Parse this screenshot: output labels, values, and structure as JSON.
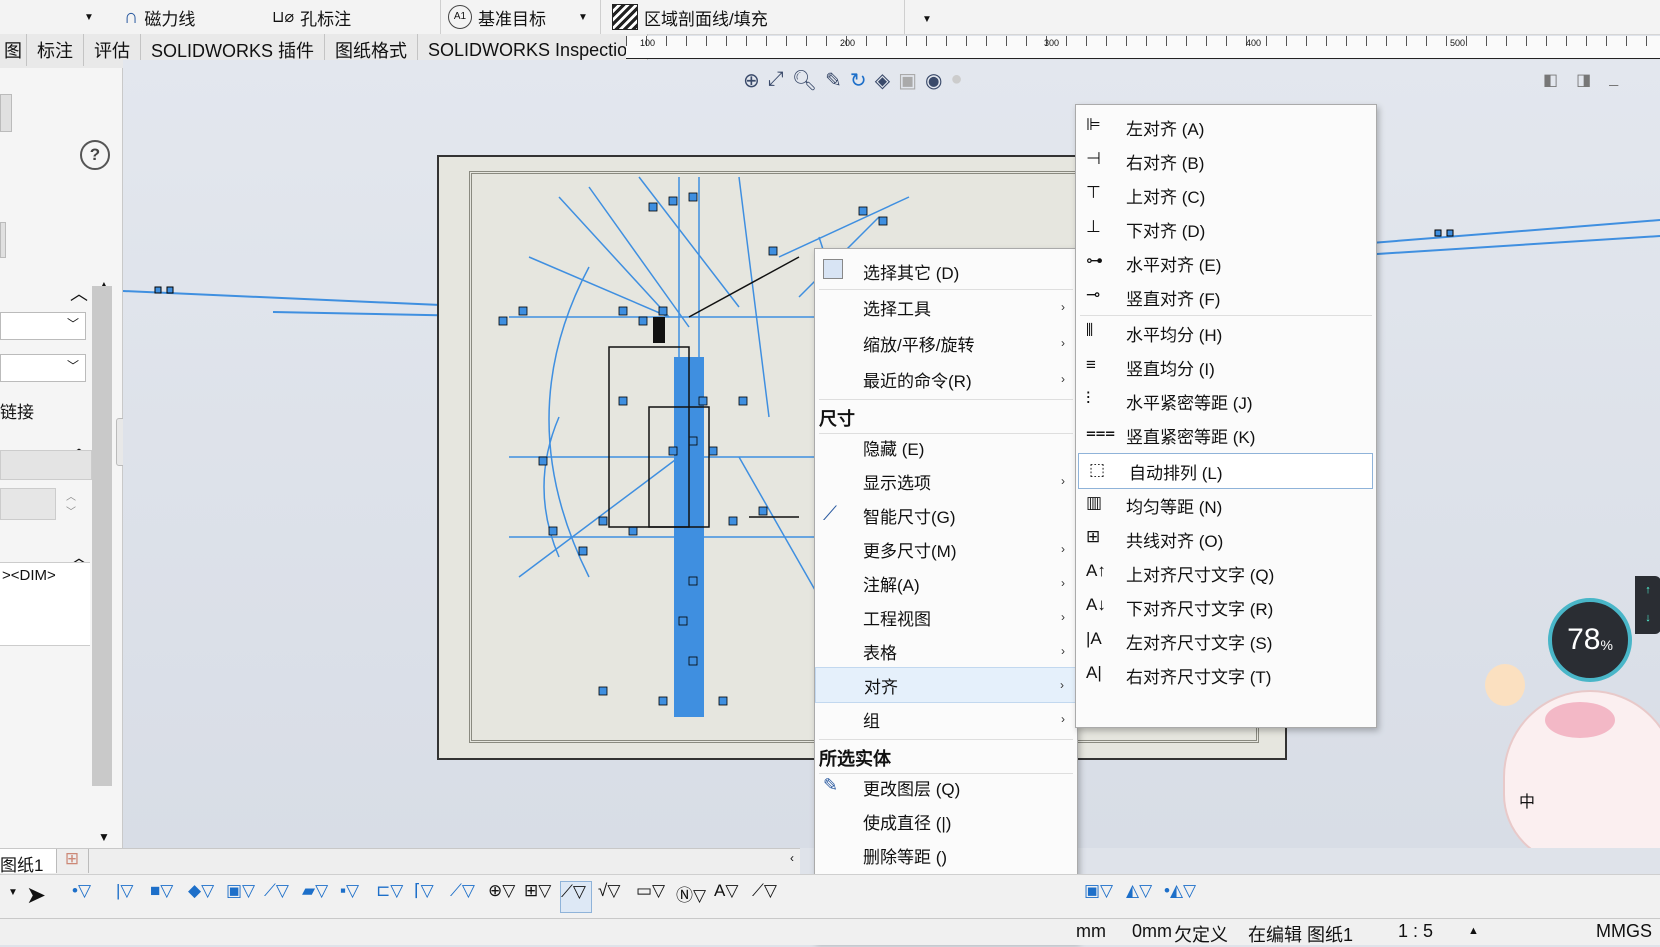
{
  "ribbon": {
    "items": [
      "磁力线",
      "孔标注",
      "基准目标",
      "区域剖面线/填充"
    ]
  },
  "tabs": [
    "图",
    "标注",
    "评估",
    "SOLIDWORKS 插件",
    "图纸格式",
    "SOLIDWORKS Inspection"
  ],
  "ruler_ticks": [
    "100",
    "200",
    "300",
    "400",
    "500"
  ],
  "left_panel": {
    "help_glyph": "?",
    "link_text": "链接",
    "dim_text": "><DIM>"
  },
  "context_menu": {
    "items": [
      {
        "label": "选择其它 (D)",
        "icon": "select-other-icon",
        "submenu": false
      },
      {
        "label": "选择工具",
        "submenu": true
      },
      {
        "label": "缩放/平移/旋转",
        "submenu": true
      },
      {
        "label": "最近的命令(R)",
        "submenu": true
      }
    ],
    "section_dim": "尺寸",
    "dim_items": [
      {
        "label": "隐藏 (E)",
        "submenu": false
      },
      {
        "label": "显示选项",
        "submenu": true
      },
      {
        "label": "智能尺寸(G)",
        "icon": "smart-dimension-icon",
        "submenu": false
      },
      {
        "label": "更多尺寸(M)",
        "submenu": true
      },
      {
        "label": "注解(A)",
        "submenu": true
      },
      {
        "label": "工程视图",
        "submenu": true
      },
      {
        "label": "表格",
        "submenu": true
      },
      {
        "label": "对齐",
        "submenu": true,
        "highlighted": true
      },
      {
        "label": "组",
        "submenu": true
      }
    ],
    "section_entity": "所选实体",
    "entity_items": [
      {
        "label": "更改图层 (Q)",
        "icon": "change-layer-icon"
      },
      {
        "label": "使成直径 (|)"
      },
      {
        "label": "删除等距 ()"
      }
    ],
    "more_glyph": "⌄"
  },
  "align_submenu": {
    "items": [
      {
        "label": "左对齐 (A)",
        "icon": "align-left-icon"
      },
      {
        "label": "右对齐 (B)",
        "icon": "align-right-icon"
      },
      {
        "label": "上对齐 (C)",
        "icon": "align-top-icon"
      },
      {
        "label": "下对齐 (D)",
        "icon": "align-bottom-icon"
      },
      {
        "label": "水平对齐 (E)",
        "icon": "align-horizontal-icon"
      },
      {
        "label": "竖直对齐 (F)",
        "icon": "align-vertical-icon"
      },
      {
        "label": "水平均分 (H)",
        "icon": "distribute-horizontal-icon"
      },
      {
        "label": "竖直均分 (I)",
        "icon": "distribute-vertical-icon"
      },
      {
        "label": "水平紧密等距 (J)",
        "icon": "space-horizontal-icon"
      },
      {
        "label": "竖直紧密等距 (K)",
        "icon": "space-vertical-icon"
      },
      {
        "label": "自动排列 (L)",
        "icon": "auto-arrange-icon",
        "highlighted": true
      },
      {
        "label": "均匀等距 (N)",
        "icon": "even-spacing-icon"
      },
      {
        "label": "共线对齐 (O)",
        "icon": "collinear-icon"
      },
      {
        "label": "上对齐尺寸文字 (Q)",
        "icon": "text-align-top-icon"
      },
      {
        "label": "下对齐尺寸文字 (R)",
        "icon": "text-align-bottom-icon"
      },
      {
        "label": "左对齐尺寸文字 (S)",
        "icon": "text-align-left-icon"
      },
      {
        "label": "右对齐尺寸文字 (T)",
        "icon": "text-align-right-icon"
      }
    ]
  },
  "sheet_tab": "图纸1",
  "status": {
    "unit_a": "mm",
    "unit_b": "0mm",
    "state": "欠定义",
    "editing": "在编辑 图纸1",
    "scale": "1 : 5",
    "units": "MMGS"
  },
  "gauge": {
    "value": "78",
    "suffix": "%"
  },
  "ime_char": "中",
  "colors": {
    "accent": "#3f8fe0",
    "highlight": "#e5f0fb",
    "sheet": "#e6e6df"
  }
}
